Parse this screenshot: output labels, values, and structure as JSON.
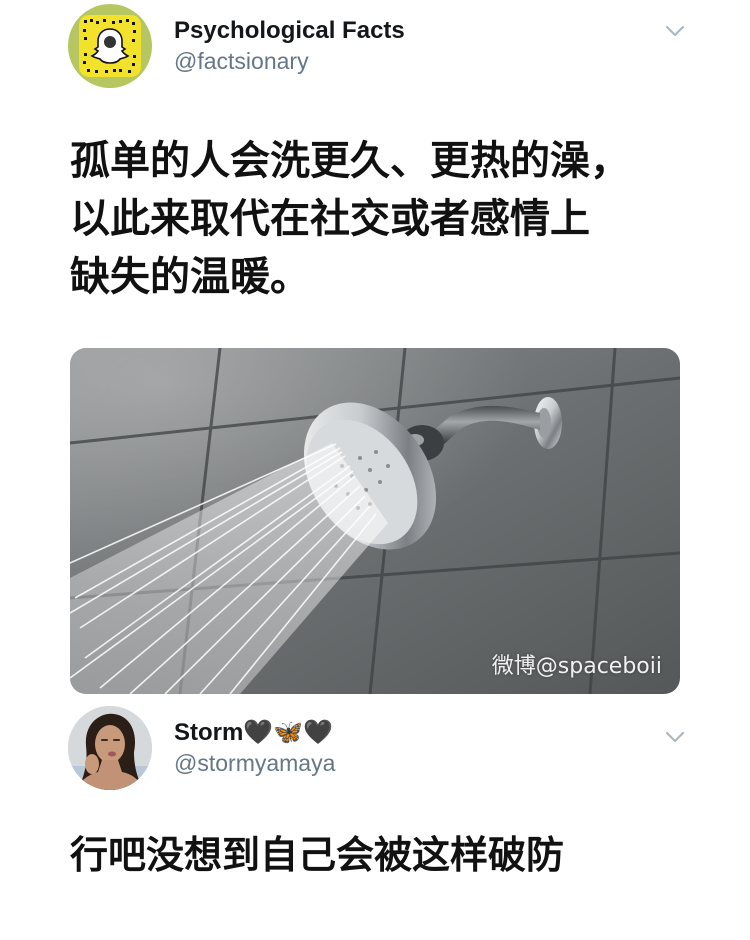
{
  "tweet1": {
    "display_name": "Psychological Facts",
    "handle": "@factsionary",
    "text_lines": [
      "孤单的人会洗更久、更热的澡，",
      "以此来取代在社交或者感情上",
      "缺失的温暖。"
    ],
    "image_watermark": "微博@spaceboii"
  },
  "tweet2": {
    "display_name": "Storm🖤🦋🖤",
    "handle": "@stormyamaya",
    "text": "行吧没想到自己会被这样破防"
  },
  "colors": {
    "handle_gray": "#657786",
    "avatar1_bg": "#b6c660",
    "snapcode_yellow": "#f3e22b"
  },
  "icons": [
    "snapcode-icon",
    "chevron-down-icon",
    "shower-head-photo",
    "profile-photo"
  ]
}
